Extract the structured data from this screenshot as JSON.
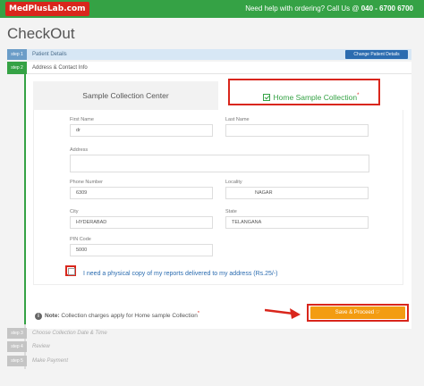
{
  "header": {
    "logo": "MedPlusLab.com",
    "help_text": "Need help with ordering? Call Us @",
    "phone": "040 - 6700 6700"
  },
  "page_title": "CheckOut",
  "steps": [
    {
      "badge": "step 1",
      "label": "Patient Details",
      "button": "Change Patient Details"
    },
    {
      "badge": "step 2",
      "label": "Address & Contact Info"
    },
    {
      "badge": "step 3",
      "label": "Choose Collection Date & Time"
    },
    {
      "badge": "step 4",
      "label": "Review"
    },
    {
      "badge": "step 5",
      "label": "Make Payment"
    }
  ],
  "tabs": {
    "center": "Sample Collection Center",
    "home": "Home Sample Collection",
    "home_mark": "*"
  },
  "form": {
    "first_name": {
      "label": "First Name",
      "value": "dr"
    },
    "last_name": {
      "label": "Last Name",
      "value": ""
    },
    "address": {
      "label": "Address",
      "value": ""
    },
    "phone": {
      "label": "Phone Number",
      "value": "6309"
    },
    "locality": {
      "label": "Locality",
      "value": "NAGAR"
    },
    "city": {
      "label": "City",
      "value": "HYDERABAD"
    },
    "state": {
      "label": "State",
      "value": "TELANGANA"
    },
    "pin": {
      "label": "PIN Code",
      "value": "5000"
    },
    "consent": "I need a physical copy of my reports delivered to my address (Rs.25/-)"
  },
  "note": {
    "prefix": "Note:",
    "text": "Collection charges apply for Home sample Collection",
    "mark": "*"
  },
  "proceed_button": "Save & Proceed"
}
